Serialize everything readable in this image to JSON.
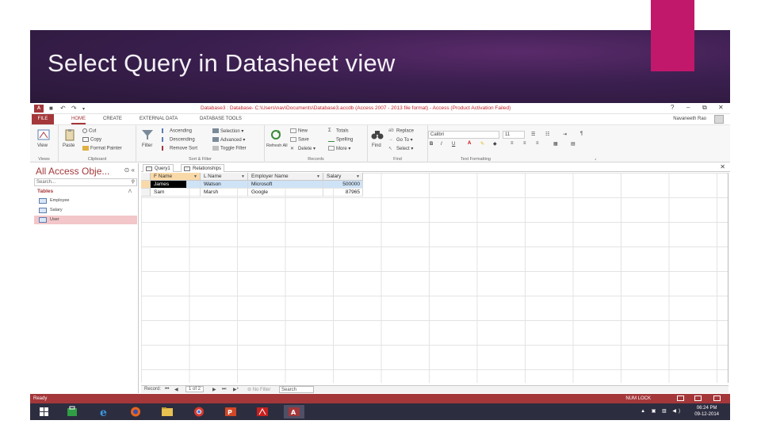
{
  "slide": {
    "title": "Select Query in Datasheet view",
    "colors": {
      "band": "#3a1f4f",
      "accent": "#c2186b",
      "access_red": "#a4373a"
    }
  },
  "titlebar": {
    "logo": "A",
    "title": "Database3 : Database- C:\\Users\\nav\\Documents\\Database3.accdb (Access 2007 - 2013 file format) - Access (Product Activation Failed)",
    "help": "?",
    "minimize": "–",
    "restore": "⧉",
    "close": "✕"
  },
  "ribbon_tabs": {
    "file": "FILE",
    "home": "HOME",
    "create": "CREATE",
    "external_data": "EXTERNAL DATA",
    "database_tools": "DATABASE TOOLS",
    "user": "Navaneeth Rao"
  },
  "ribbon": {
    "views": {
      "view": "View",
      "label": "Views"
    },
    "clipboard": {
      "paste": "Paste",
      "cut": "Cut",
      "copy": "Copy",
      "format_painter": "Format Painter",
      "label": "Clipboard"
    },
    "sort_filter": {
      "filter": "Filter",
      "ascending": "Ascending",
      "descending": "Descending",
      "remove_sort": "Remove Sort",
      "selection": "Selection",
      "advanced": "Advanced",
      "toggle_filter": "Toggle Filter",
      "label": "Sort & Filter"
    },
    "records": {
      "refresh": "Refresh All",
      "new": "New",
      "save": "Save",
      "delete": "Delete",
      "totals": "Totals",
      "spelling": "Spelling",
      "more": "More",
      "label": "Records"
    },
    "find": {
      "find": "Find",
      "replace": "Replace",
      "goto": "Go To",
      "select": "Select",
      "label": "Find"
    },
    "text_formatting": {
      "font": "Calibri",
      "size": "11",
      "bold": "B",
      "italic": "I",
      "underline": "U",
      "label": "Text Formatting"
    }
  },
  "nav_pane": {
    "title": "All Access Obje...",
    "search_placeholder": "Search...",
    "section": "Tables",
    "items": [
      {
        "label": "Employee",
        "selected": false
      },
      {
        "label": "Salary",
        "selected": false
      },
      {
        "label": "User",
        "selected": true
      }
    ]
  },
  "doc_tabs": [
    {
      "label": "Query1"
    },
    {
      "label": "Relationships"
    }
  ],
  "grid": {
    "columns": [
      "F Name",
      "L Name",
      "Employer Name",
      "Salary"
    ],
    "rows": [
      {
        "f_name": "James",
        "l_name": "Watson",
        "employer": "Microsoft",
        "salary": "500000"
      },
      {
        "f_name": "Sam",
        "l_name": "Marsh",
        "employer": "Google",
        "salary": "87965"
      }
    ]
  },
  "record_nav": {
    "record_label": "Record:",
    "first": "⏮",
    "prev": "◀",
    "position": "1 of 2",
    "next": "▶",
    "last": "⏭",
    "new": "▶*",
    "filter": "No Filter",
    "search": "Search"
  },
  "status_bar": {
    "left": "Ready",
    "numlock": "NUM LOCK"
  },
  "taskbar": {
    "time": "06:24 PM",
    "date": "09-12-2014"
  }
}
